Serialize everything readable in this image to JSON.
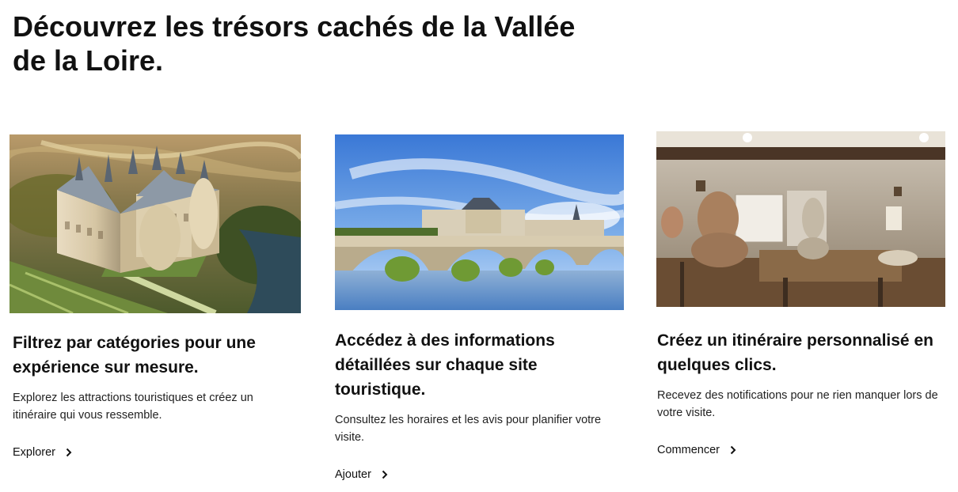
{
  "header": {
    "title": "Découvrez les trésors cachés de la Vallée de la Loire."
  },
  "cards": [
    {
      "image_alt": "château de Chambord vu du ciel",
      "title": "Filtrez par catégories pour une expérience sur mesure.",
      "description": "Explorez les attractions touristiques et créez un itinéraire qui vous ressemble.",
      "link_label": "Explorer",
      "link_icon": "chevron-right-icon"
    },
    {
      "image_alt": "château d'Amboise et pont sur la Loire",
      "title": "Accédez à des informations détaillées sur chaque site touristique.",
      "description": "Consultez les horaires et les avis pour planifier votre visite.",
      "link_label": "Ajouter",
      "link_icon": "chevron-right-icon"
    },
    {
      "image_alt": "atelier de sculpteur avec bustes",
      "title": "Créez un itinéraire personnalisé en quelques clics.",
      "description": "Recevez des notifications pour ne rien manquer lors de votre visite.",
      "link_label": "Commencer",
      "link_icon": "chevron-right-icon"
    }
  ]
}
